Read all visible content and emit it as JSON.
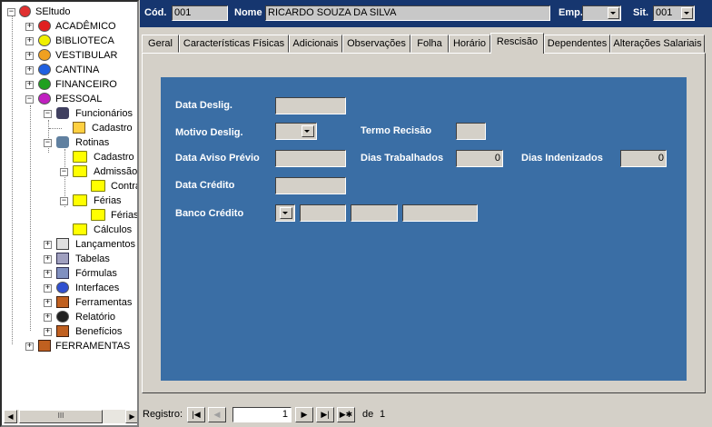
{
  "tree": {
    "root": "SEltudo",
    "nodes": {
      "academico": "ACADÊMICO",
      "biblioteca": "BIBLIOTECA",
      "vestibular": "VESTIBULAR",
      "cantina": "CANTINA",
      "financeiro": "FINANCEIRO",
      "pessoal": "PESSOAL",
      "funcionarios": "Funcionários",
      "cadastro1": "Cadastro",
      "rotinas": "Rotinas",
      "cadastro2": "Cadastro",
      "admissao": "Admissão",
      "contra": "Contra",
      "ferias": "Férias",
      "ferias2": "Férias",
      "calculos": "Cálculos",
      "lancamentos": "Lançamentos",
      "tabelas": "Tabelas",
      "formulas": "Fórmulas",
      "interfaces": "Interfaces",
      "ferramentas1": "Ferramentas",
      "relatorio": "Relatório",
      "beneficios": "Benefícios",
      "ferramentas2": "FERRAMENTAS"
    },
    "scroll_grip": "III"
  },
  "header": {
    "cod_label": "Cód.",
    "cod_value": "001",
    "nome_label": "Nome",
    "nome_value": "RICARDO SOUZA DA SILVA",
    "emp_label": "Emp.",
    "emp_value": "",
    "sit_label": "Sit.",
    "sit_value": "001"
  },
  "tabs": [
    "Geral",
    "Características Físicas",
    "Adicionais",
    "Observações",
    "Folha",
    "Horário",
    "Rescisão",
    "Dependentes",
    "Alterações Salariais"
  ],
  "active_tab": "Rescisão",
  "form": {
    "data_deslig_label": "Data Deslig.",
    "data_deslig_value": "",
    "motivo_deslig_label": "Motivo Deslig.",
    "motivo_deslig_value": "",
    "termo_recisao_label": "Termo Recisão",
    "termo_recisao_value": "",
    "data_aviso_label": "Data Aviso Prévio",
    "data_aviso_value": "",
    "dias_trabalhados_label": "Dias Trabalhados",
    "dias_trabalhados_value": "0",
    "dias_indenizados_label": "Dias Indenizados",
    "dias_indenizados_value": "0",
    "data_credito_label": "Data Crédito",
    "data_credito_value": "",
    "banco_credito_label": "Banco Crédito",
    "banco_credito_value": ""
  },
  "navbar": {
    "registro_label": "Registro:",
    "record_value": "1",
    "de_label": "de",
    "total": "1",
    "buttons": {
      "first": "|◀",
      "prev": "◀",
      "next": "▶",
      "last": "▶|",
      "new": "▶✱"
    }
  },
  "colors": {
    "header_bg": "#16366f",
    "form_bg": "#3a6ea5",
    "window_bg": "#d4d0c8"
  }
}
